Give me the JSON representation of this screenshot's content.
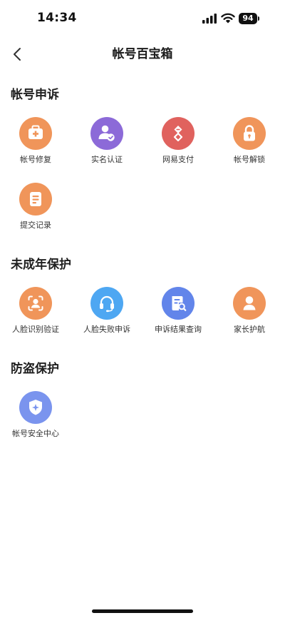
{
  "status_bar": {
    "time": "14:34",
    "battery": "94"
  },
  "nav": {
    "title": "帐号百宝箱"
  },
  "sections": [
    {
      "title": "帐号申诉",
      "items": [
        {
          "label": "帐号修复",
          "icon": "medkit-icon",
          "color": "#F0955A"
        },
        {
          "label": "实名认证",
          "icon": "user-verified-icon",
          "color": "#8C6AD8"
        },
        {
          "label": "网易支付",
          "icon": "netease-pay-icon",
          "color": "#E0625E"
        },
        {
          "label": "帐号解锁",
          "icon": "unlock-icon",
          "color": "#F0955A"
        },
        {
          "label": "提交记录",
          "icon": "record-icon",
          "color": "#F0955A"
        }
      ]
    },
    {
      "title": "未成年保护",
      "items": [
        {
          "label": "人脸识别验证",
          "icon": "face-scan-icon",
          "color": "#F0955A"
        },
        {
          "label": "人脸失败申诉",
          "icon": "headset-icon",
          "color": "#4EA7F2"
        },
        {
          "label": "申诉结果查询",
          "icon": "document-search-icon",
          "color": "#6285EA"
        },
        {
          "label": "家长护航",
          "icon": "parent-icon",
          "color": "#F0955A"
        }
      ]
    },
    {
      "title": "防盗保护",
      "items": [
        {
          "label": "帐号安全中心",
          "icon": "shield-icon",
          "color": "#7A94EE"
        }
      ]
    }
  ]
}
